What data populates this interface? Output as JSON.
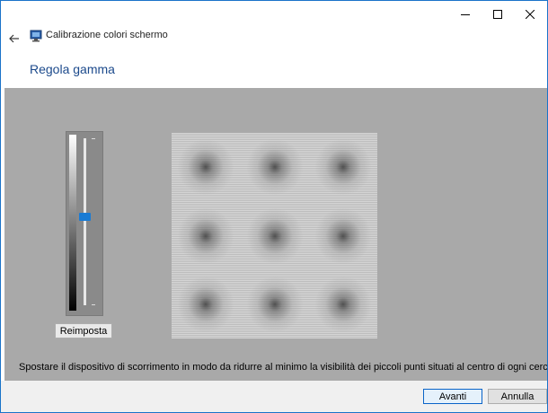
{
  "window": {
    "title": "Calibrazione colori schermo",
    "controls": [
      "minimize-icon",
      "maximize-icon",
      "close-icon"
    ]
  },
  "nav": {
    "back_icon": "arrow-left-icon",
    "app_icon": "monitor-icon"
  },
  "page": {
    "heading": "Regola gamma"
  },
  "gamma_slider": {
    "value_fraction": 0.47
  },
  "buttons": {
    "reset_label": "Reimposta",
    "next_label": "Avanti",
    "cancel_label": "Annulla"
  },
  "instruction": "Spostare il dispositivo di scorrimento in modo da ridurre al minimo la visibilità dei piccoli punti situati al centro di ogni cerchio.",
  "colors": {
    "accent": "#1a7bd4",
    "heading": "#1c4a8c",
    "panel": "#a9a9a9",
    "border": "#1a73c9"
  }
}
